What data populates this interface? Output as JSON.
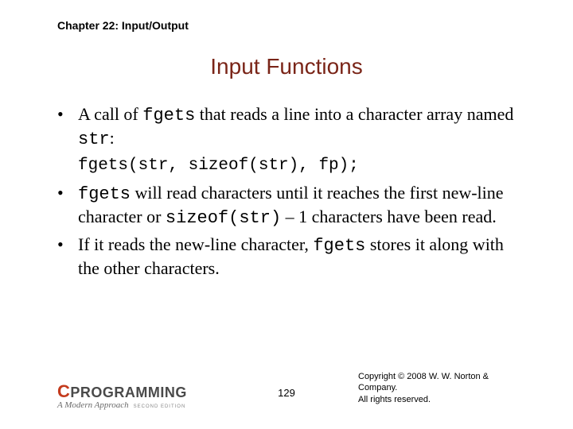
{
  "chapter_header": "Chapter 22: Input/Output",
  "title": "Input Functions",
  "bullets": {
    "b1_pre": "A call of ",
    "b1_code1": "fgets",
    "b1_mid": " that reads a line into a character array named ",
    "b1_code2": "str",
    "b1_post": ":",
    "codeblock": "fgets(str, sizeof(str), fp);",
    "b2_code1": "fgets",
    "b2_mid": " will read characters until it reaches the first new-line character or ",
    "b2_code2": "sizeof(str)",
    "b2_mid2": " – 1 characters have been read.",
    "b3_pre": "If it reads the new-line character, ",
    "b3_code1": "fgets",
    "b3_post": " stores it along with the other characters."
  },
  "logo": {
    "c": "C",
    "prog": "PROGRAMMING",
    "sub": "A Modern Approach",
    "ed": "SECOND EDITION"
  },
  "page_number": "129",
  "copyright_l1": "Copyright © 2008 W. W. Norton & Company.",
  "copyright_l2": "All rights reserved."
}
